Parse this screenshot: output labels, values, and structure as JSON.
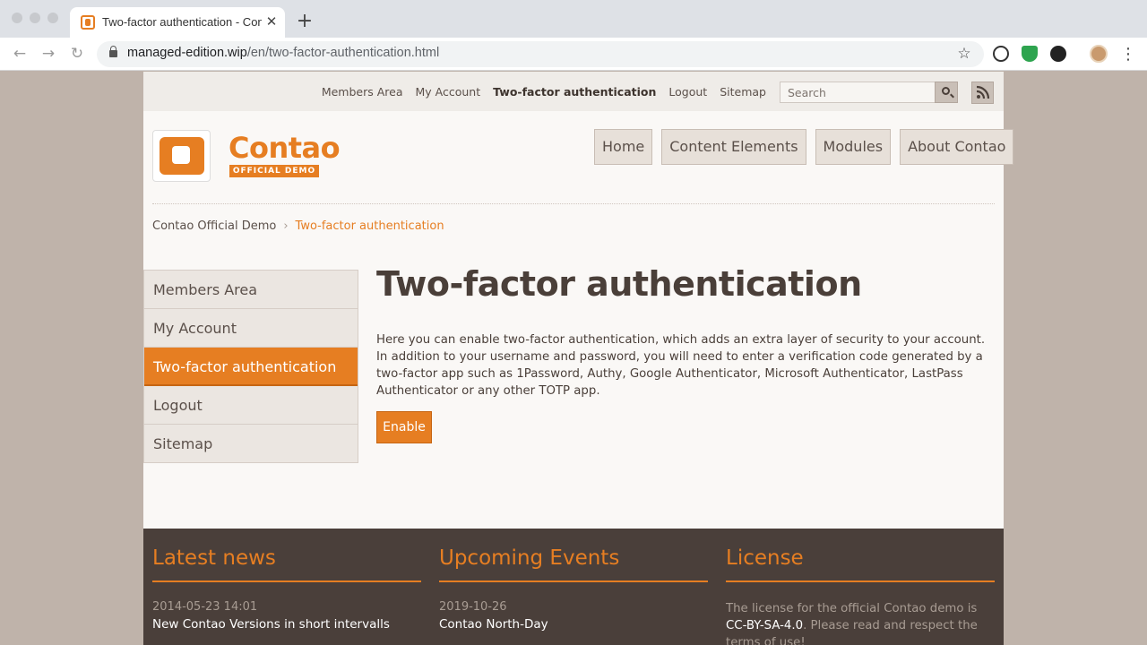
{
  "browser": {
    "tab_title": "Two-factor authentication - Contao Official Demo",
    "tab_close": "✕",
    "new_tab": "+",
    "url_host": "managed-edition.wip",
    "url_path": "/en/two-factor-authentication.html",
    "back": "←",
    "forward": "→",
    "reload": "↻",
    "bookmark_star": "☆",
    "menu": "⋮"
  },
  "topbar": {
    "links": [
      "Members Area",
      "My Account",
      "Two-factor authentication",
      "Logout",
      "Sitemap"
    ],
    "search_placeholder": "Search"
  },
  "logo": {
    "name": "Contao",
    "subtitle": "OFFICIAL DEMO"
  },
  "mainnav": [
    "Home",
    "Content Elements",
    "Modules",
    "About Contao"
  ],
  "breadcrumb": {
    "root": "Contao Official Demo",
    "separator": "›",
    "current": "Two-factor authentication"
  },
  "sidenav": [
    "Members Area",
    "My Account",
    "Two-factor authentication",
    "Logout",
    "Sitemap"
  ],
  "content": {
    "headline": "Two-factor authentication",
    "text": "Here you can enable two-factor authentication, which adds an extra layer of security to your account. In addition to your username and password, you will need to enter a verification code generated by a two-factor app such as 1Password, Authy, Google Authenticator, Microsoft Authenticator, LastPass Authenticator or any other TOTP app.",
    "enable_label": "Enable"
  },
  "footer": {
    "news": {
      "heading": "Latest news",
      "date": "2014-05-23 14:01",
      "title": "New Contao Versions in short intervalls"
    },
    "events": {
      "heading": "Upcoming Events",
      "date": "2019-10-26",
      "title": "Contao North-Day"
    },
    "license": {
      "heading": "License",
      "text_before": "The license for the official Contao demo is ",
      "link": "CC-BY-SA-4.0",
      "text_after": ". Please read and respect the terms of use!"
    }
  },
  "colors": {
    "accent": "#e67e22",
    "text": "#4a3f39",
    "footer_bg": "#4a3f3a",
    "page_bg": "#bfb3aa"
  }
}
